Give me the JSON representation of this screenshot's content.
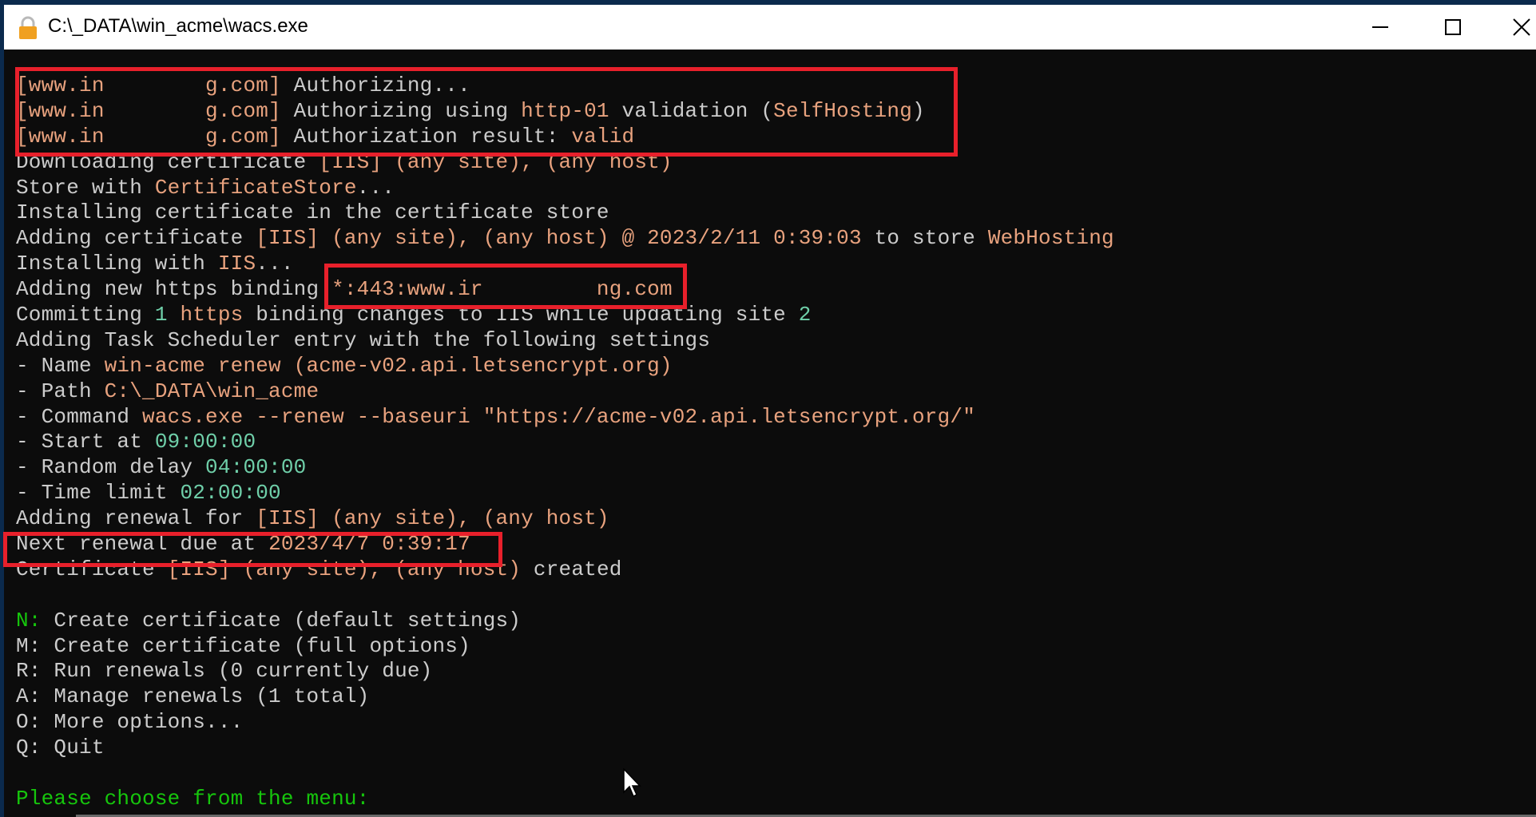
{
  "window": {
    "title": "C:\\_DATA\\win_acme\\wacs.exe",
    "icon": "lock-icon",
    "controls": {
      "minimize": "minimize-icon",
      "maximize": "maximize-icon",
      "close": "close-icon"
    }
  },
  "console": {
    "lines": [
      {
        "segments": [
          {
            "text": "[www.in        g.com] ",
            "color": "o"
          },
          {
            "text": "Authorizing...",
            "color": "w"
          }
        ]
      },
      {
        "segments": [
          {
            "text": "[www.in        g.com] ",
            "color": "o"
          },
          {
            "text": "Authorizing using ",
            "color": "w"
          },
          {
            "text": "http-01",
            "color": "o"
          },
          {
            "text": " validation (",
            "color": "w"
          },
          {
            "text": "SelfHosting",
            "color": "o"
          },
          {
            "text": ")",
            "color": "w"
          }
        ]
      },
      {
        "segments": [
          {
            "text": "[www.in        g.com] ",
            "color": "o"
          },
          {
            "text": "Authorization result: ",
            "color": "w"
          },
          {
            "text": "valid",
            "color": "o"
          }
        ]
      },
      {
        "segments": [
          {
            "text": "Downloading certificate ",
            "color": "w"
          },
          {
            "text": "[IIS] (any site), (any host)",
            "color": "o"
          }
        ]
      },
      {
        "segments": [
          {
            "text": "Store with ",
            "color": "w"
          },
          {
            "text": "CertificateStore",
            "color": "o"
          },
          {
            "text": "...",
            "color": "w"
          }
        ]
      },
      {
        "segments": [
          {
            "text": "Installing certificate in the certificate store",
            "color": "w"
          }
        ]
      },
      {
        "segments": [
          {
            "text": "Adding certificate ",
            "color": "w"
          },
          {
            "text": "[IIS] (any site), (any host) @ 2023/2/11 0:39:03",
            "color": "o"
          },
          {
            "text": " to store ",
            "color": "w"
          },
          {
            "text": "WebHosting",
            "color": "o"
          }
        ]
      },
      {
        "segments": [
          {
            "text": "Installing with ",
            "color": "w"
          },
          {
            "text": "IIS",
            "color": "o"
          },
          {
            "text": "...",
            "color": "w"
          }
        ]
      },
      {
        "segments": [
          {
            "text": "Adding new https binding ",
            "color": "w"
          },
          {
            "text": "*:443:www.ir         ng.com",
            "color": "o"
          }
        ]
      },
      {
        "segments": [
          {
            "text": "Committing ",
            "color": "w"
          },
          {
            "text": "1",
            "color": "t"
          },
          {
            "text": " ",
            "color": "w"
          },
          {
            "text": "https",
            "color": "o"
          },
          {
            "text": " binding changes to IIS while updating site ",
            "color": "w"
          },
          {
            "text": "2",
            "color": "t"
          }
        ]
      },
      {
        "segments": [
          {
            "text": "Adding Task Scheduler entry with the following settings",
            "color": "w"
          }
        ]
      },
      {
        "segments": [
          {
            "text": "- Name ",
            "color": "w"
          },
          {
            "text": "win-acme renew (acme-v02.api.letsencrypt.org)",
            "color": "o"
          }
        ]
      },
      {
        "segments": [
          {
            "text": "- Path ",
            "color": "w"
          },
          {
            "text": "C:\\_DATA\\win_acme",
            "color": "o"
          }
        ]
      },
      {
        "segments": [
          {
            "text": "- Command ",
            "color": "w"
          },
          {
            "text": "wacs.exe --renew --baseuri \"https://acme-v02.api.letsencrypt.org/\"",
            "color": "o"
          }
        ]
      },
      {
        "segments": [
          {
            "text": "- Start at ",
            "color": "w"
          },
          {
            "text": "09:00:00",
            "color": "t"
          }
        ]
      },
      {
        "segments": [
          {
            "text": "- Random delay ",
            "color": "w"
          },
          {
            "text": "04:00:00",
            "color": "t"
          }
        ]
      },
      {
        "segments": [
          {
            "text": "- Time limit ",
            "color": "w"
          },
          {
            "text": "02:00:00",
            "color": "t"
          }
        ]
      },
      {
        "segments": [
          {
            "text": "Adding renewal for ",
            "color": "w"
          },
          {
            "text": "[IIS] (any site), (any host)",
            "color": "o"
          }
        ]
      },
      {
        "segments": [
          {
            "text": "Next renewal due at ",
            "color": "w"
          },
          {
            "text": "2023/4/7 0:39:17",
            "color": "o"
          }
        ]
      },
      {
        "segments": [
          {
            "text": "Certificate ",
            "color": "w"
          },
          {
            "text": "[IIS] (any site), (any host)",
            "color": "o"
          },
          {
            "text": " created",
            "color": "w"
          }
        ]
      },
      {
        "segments": [
          {
            "text": "",
            "color": "w"
          }
        ]
      },
      {
        "segments": [
          {
            "text": "N:",
            "color": "g"
          },
          {
            "text": " Create certificate (default settings)",
            "color": "w"
          }
        ]
      },
      {
        "segments": [
          {
            "text": "M: Create certificate (full options)",
            "color": "w"
          }
        ]
      },
      {
        "segments": [
          {
            "text": "R: Run renewals (0 currently due)",
            "color": "w"
          }
        ]
      },
      {
        "segments": [
          {
            "text": "A: Manage renewals (1 total)",
            "color": "w"
          }
        ]
      },
      {
        "segments": [
          {
            "text": "O: More options...",
            "color": "w"
          }
        ]
      },
      {
        "segments": [
          {
            "text": "Q: Quit",
            "color": "w"
          }
        ]
      },
      {
        "segments": [
          {
            "text": "",
            "color": "w"
          }
        ]
      },
      {
        "segments": [
          {
            "text": "Please choose from the menu:",
            "color": "g"
          }
        ]
      }
    ]
  },
  "menu": {
    "options": [
      {
        "key": "N",
        "label": "Create certificate (default settings)"
      },
      {
        "key": "M",
        "label": "Create certificate (full options)"
      },
      {
        "key": "R",
        "label": "Run renewals (0 currently due)"
      },
      {
        "key": "A",
        "label": "Manage renewals (1 total)"
      },
      {
        "key": "O",
        "label": "More options..."
      },
      {
        "key": "Q",
        "label": "Quit"
      }
    ],
    "prompt": "Please choose from the menu:"
  },
  "colors": {
    "background": "#0c0c0c",
    "default_text": "#cccccc",
    "highlight_text": "#e8a27e",
    "number_text": "#6fcfa9",
    "green_text": "#16c60c",
    "annotation_box": "#e8202b"
  }
}
